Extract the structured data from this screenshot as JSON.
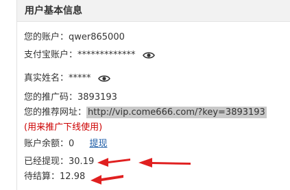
{
  "panel": {
    "title": "用户基本信息"
  },
  "account": {
    "label": "您的账户：",
    "value": "qwer865000"
  },
  "alipay": {
    "label": "支付宝账户：",
    "value": "*************",
    "icon": "eye-icon"
  },
  "realname": {
    "label": "真实姓名：",
    "value": "*****",
    "icon": "eye-icon"
  },
  "promo_code": {
    "label": "您的推广码：",
    "value": "3893193"
  },
  "referral": {
    "label": "您的推荐网址：",
    "url": "http://vip.come666.com/?key=3893193",
    "note": "(用来推广下线使用)"
  },
  "balance": {
    "label": "账户余额：",
    "value": "0",
    "withdraw_link": "提现"
  },
  "withdrawn": {
    "label": "已经提现：",
    "value": "30.19"
  },
  "pending": {
    "label": "待结算：",
    "value": "12.98"
  },
  "colors": {
    "annotation_arrow": "#e02020",
    "note_text": "#cc0000",
    "link": "#1f5ea8",
    "url_highlight": "#c9c9c9"
  }
}
